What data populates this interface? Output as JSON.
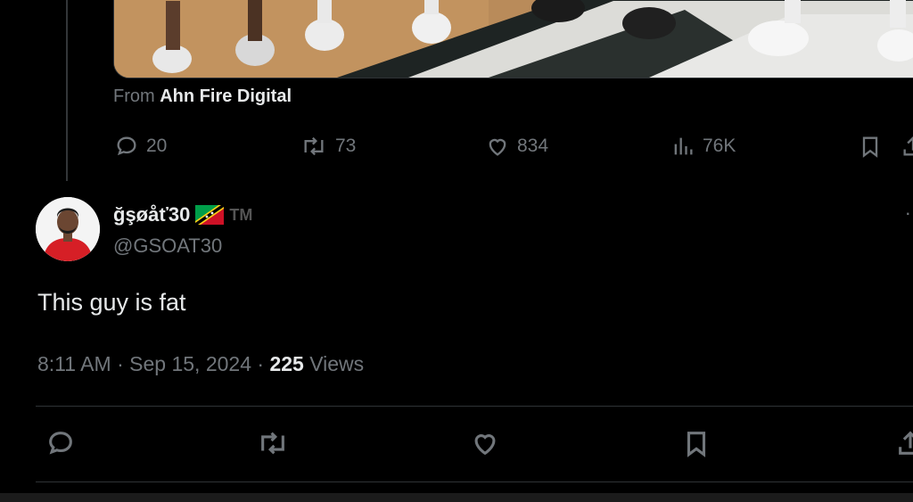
{
  "source": {
    "prefix": "From",
    "name": "Ahn Fire Digital"
  },
  "parent_actions": {
    "replies": "20",
    "reposts": "73",
    "likes": "834",
    "views": "76K"
  },
  "reply": {
    "display_name": "ğşøåť30",
    "flag_icon": "saint-kitts-and-nevis-flag-icon",
    "trademark": "TM",
    "handle": "@GSOAT30",
    "text": "This guy is fat",
    "time": "8:11 AM",
    "separator": "·",
    "date": "Sep 15, 2024",
    "views_count": "225",
    "views_label": "Views",
    "more": "·"
  },
  "colors": {
    "background": "#000000",
    "muted": "#71767b",
    "text": "#e7e9ea",
    "divider": "#2f3336"
  }
}
